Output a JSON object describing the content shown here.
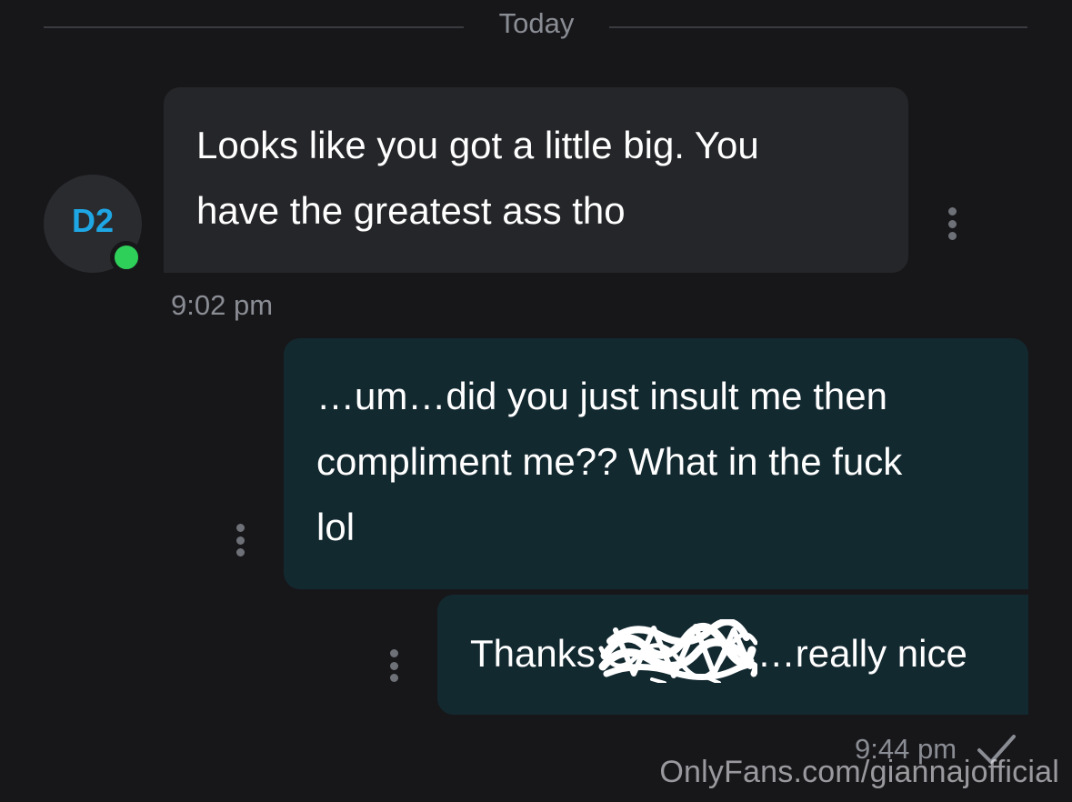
{
  "date_divider": {
    "label": "Today"
  },
  "contact": {
    "initials": "D2",
    "initials_color": "#1ea7e4",
    "online_status_color": "#2fd05a"
  },
  "messages": [
    {
      "direction": "incoming",
      "lines": [
        "Looks like you got a little big. You",
        "have the greatest ass tho"
      ],
      "timestamp": "9:02 pm",
      "menu_icon": "more-vertical-icon"
    },
    {
      "direction": "outgoing",
      "lines": [
        "…um…did you just insult me then",
        "compliment me?? What in the fuck",
        "lol"
      ],
      "menu_icon": "more-vertical-icon"
    },
    {
      "direction": "outgoing",
      "text_before_redaction": "Thanks",
      "text_after_redaction": "…really nice",
      "timestamp": "9:44 pm",
      "status_icon": "checkmark-icon",
      "menu_icon": "more-vertical-icon"
    }
  ],
  "watermark": {
    "text": "OnlyFans.com/giannajofficial"
  },
  "colors": {
    "background": "#17171a",
    "incoming_bubble": "#252629",
    "outgoing_bubble": "#132930",
    "meta_text": "#8a8d94"
  }
}
